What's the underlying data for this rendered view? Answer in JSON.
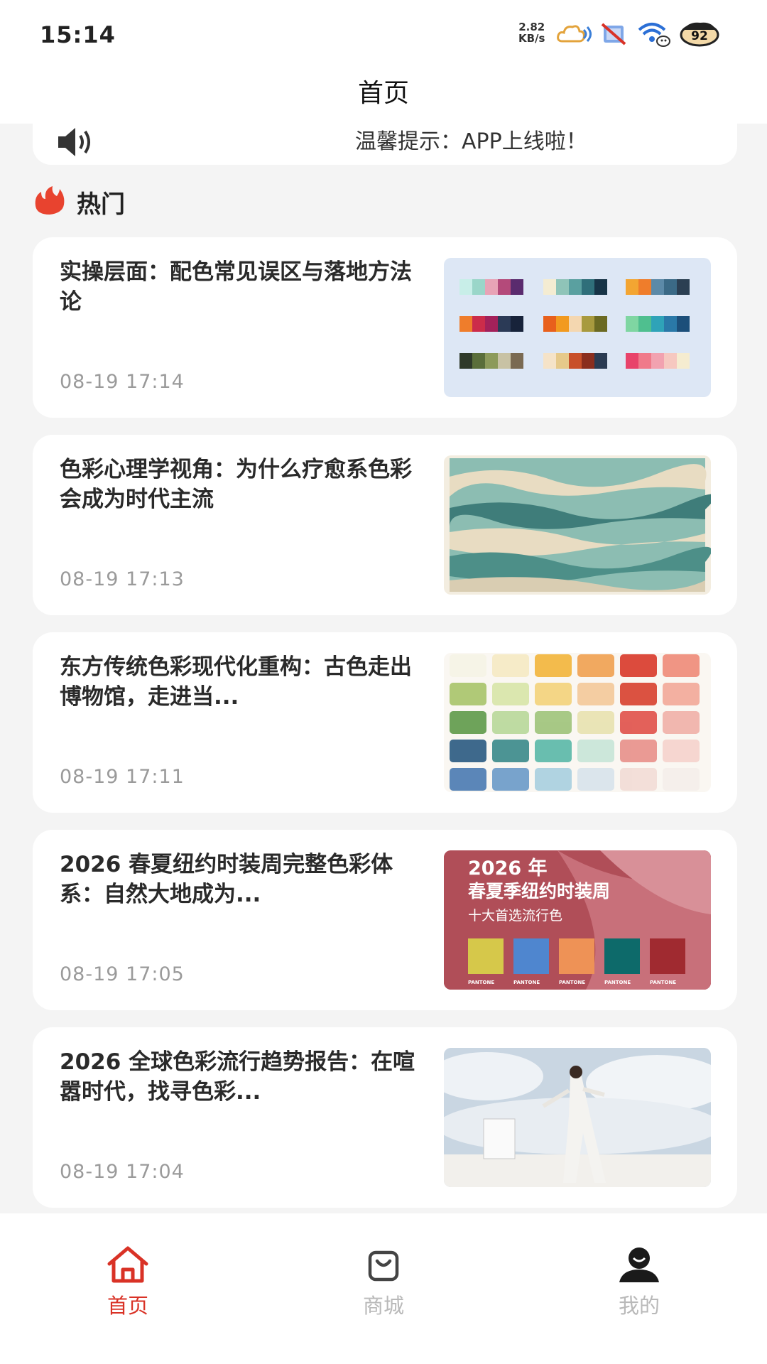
{
  "status_bar": {
    "time": "15:14",
    "net_speed_value": "2.82",
    "net_speed_unit": "KB/s",
    "battery": "92",
    "icons": [
      "cloud-icon",
      "sim-off-icon",
      "wifi-icon",
      "battery-icon"
    ]
  },
  "header": {
    "title": "首页"
  },
  "notice": {
    "icon": "speaker-icon",
    "text": "温馨提示：APP上线啦！"
  },
  "section": {
    "icon": "flame-icon",
    "label": "热门",
    "accent": "#e8432f"
  },
  "articles": [
    {
      "title": "实操层面：配色常见误区与落地方法论",
      "time": "08-19 17:14",
      "image": "color-palette-swatches"
    },
    {
      "title": "色彩心理学视角：为什么疗愈系色彩会成为时代主流",
      "time": "08-19 17:13",
      "image": "marbled-waves"
    },
    {
      "title": "东方传统色彩现代化重构：古色走出博物馆，走进当...",
      "time": "08-19 17:11",
      "image": "watercolor-swatches"
    },
    {
      "title": "2026 春夏纽约时装周完整色彩体系：自然大地成为...",
      "time": "08-19 17:05",
      "image": "nyfw-palette-poster",
      "image_text": {
        "line1": "2026 年",
        "line2": "春夏季纽约时装周",
        "line3": "十大首选流行色",
        "brand": "PANTONE"
      }
    },
    {
      "title": "2026 全球色彩流行趋势报告：在喧嚣时代，找寻色彩...",
      "time": "08-19 17:04",
      "image": "cloud-dancer-photo"
    }
  ],
  "tabbar": {
    "items": [
      {
        "label": "首页",
        "icon": "home-icon",
        "active": true
      },
      {
        "label": "商城",
        "icon": "shopping-bag-icon",
        "active": false
      },
      {
        "label": "我的",
        "icon": "profile-icon",
        "active": false
      }
    ],
    "active_color": "#d93226",
    "inactive_color": "#b9b9b9"
  }
}
